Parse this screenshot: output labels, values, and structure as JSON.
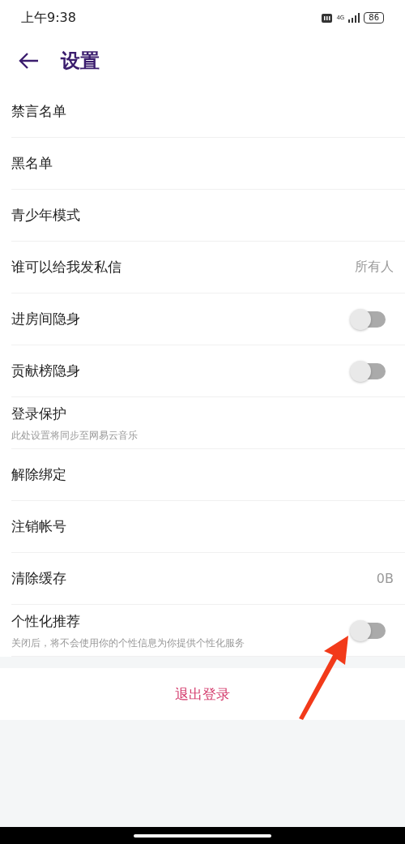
{
  "status_bar": {
    "time": "上午9:38",
    "network": "4G",
    "battery": "86"
  },
  "header": {
    "title": "设置"
  },
  "items": [
    {
      "kind": "plain",
      "label": "禁言名单"
    },
    {
      "kind": "plain",
      "label": "黑名单"
    },
    {
      "kind": "plain",
      "label": "青少年模式"
    },
    {
      "kind": "value",
      "label": "谁可以给我发私信",
      "value": "所有人"
    },
    {
      "kind": "toggle",
      "label": "进房间隐身",
      "on": false
    },
    {
      "kind": "toggle",
      "label": "贡献榜隐身",
      "on": false
    },
    {
      "kind": "plain",
      "label": "登录保护",
      "note": "此处设置将同步至网易云音乐"
    },
    {
      "kind": "plain",
      "label": "解除绑定"
    },
    {
      "kind": "plain",
      "label": "注销帐号"
    },
    {
      "kind": "value",
      "label": "清除缓存",
      "value": "0B"
    },
    {
      "kind": "toggle",
      "label": "个性化推荐",
      "note": "关闭后，将不会使用你的个性信息为你提供个性化服务",
      "on": false
    }
  ],
  "logout": "退出登录"
}
